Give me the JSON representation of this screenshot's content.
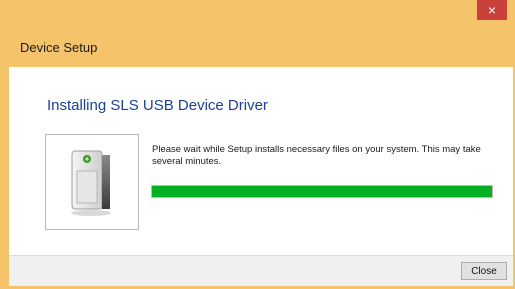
{
  "window": {
    "close_glyph": "×"
  },
  "dialog": {
    "title": "Device Setup",
    "heading": "Installing SLS USB Device Driver",
    "message": "Please wait while Setup installs necessary files on your system. This may take several minutes.",
    "progress_percent": 100,
    "device_icon": "external-drive-icon"
  },
  "footer": {
    "close_label": "Close"
  },
  "colors": {
    "title_bar": "#f4c36a",
    "heading": "#1c3f96",
    "progress_fill": "#06b025",
    "window_close": "#c9413a"
  }
}
